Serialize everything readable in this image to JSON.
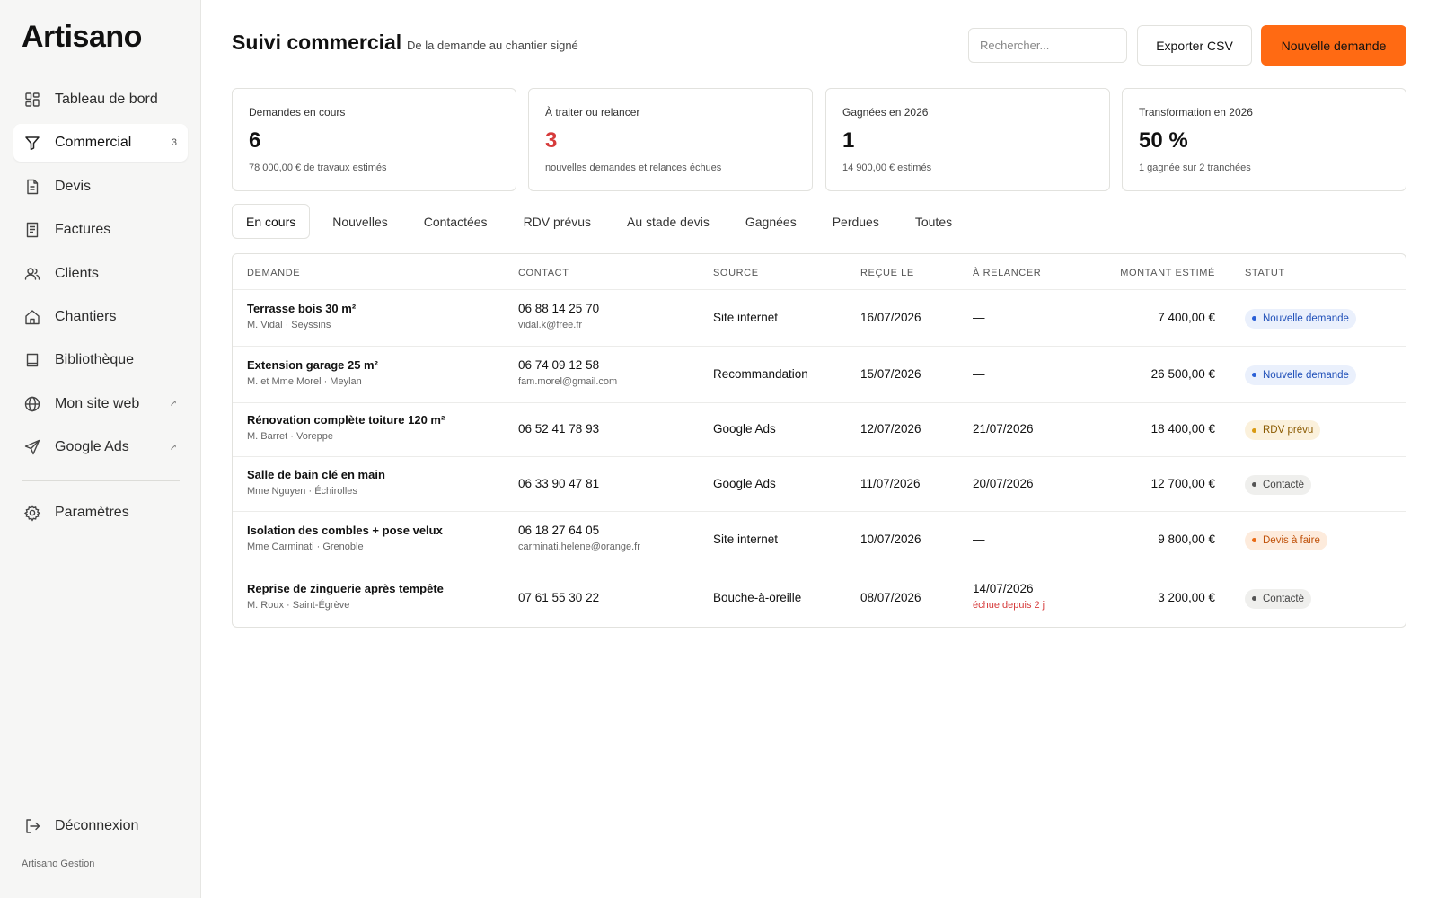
{
  "sidebar": {
    "logo": "Artisano",
    "items": [
      {
        "label": "Tableau de bord",
        "icon": "dashboard-icon"
      },
      {
        "label": "Commercial",
        "icon": "funnel-icon",
        "count": "3"
      },
      {
        "label": "Devis",
        "icon": "document-icon"
      },
      {
        "label": "Factures",
        "icon": "receipt-icon"
      },
      {
        "label": "Clients",
        "icon": "users-icon"
      },
      {
        "label": "Chantiers",
        "icon": "home-icon"
      },
      {
        "label": "Bibliothèque",
        "icon": "book-icon"
      },
      {
        "label": "Mon site web",
        "icon": "globe-icon",
        "ext": "↗"
      },
      {
        "label": "Google Ads",
        "icon": "send-icon",
        "ext": "↗"
      }
    ],
    "settings": "Paramètres",
    "logout": "Déconnexion",
    "footer": "Artisano Gestion"
  },
  "header": {
    "title": "Suivi commercial",
    "subtitle": "De la demande au chantier signé",
    "search_placeholder": "Rechercher...",
    "export_label": "Exporter CSV",
    "new_label": "Nouvelle demande"
  },
  "kpis": [
    {
      "label": "Demandes en cours",
      "value": "6",
      "sub": "78 000,00 € de travaux estimés"
    },
    {
      "label": "À traiter ou relancer",
      "value": "3",
      "sub": "nouvelles demandes et relances échues"
    },
    {
      "label": "Gagnées en 2026",
      "value": "1",
      "sub": "14 900,00 € estimés"
    },
    {
      "label": "Transformation en 2026",
      "value": "50 %",
      "sub": "1 gagnée sur 2 tranchées"
    }
  ],
  "tabs": [
    "En cours",
    "Nouvelles",
    "Contactées",
    "RDV prévus",
    "Au stade devis",
    "Gagnées",
    "Perdues",
    "Toutes"
  ],
  "table": {
    "headers": [
      "Demande",
      "Contact",
      "Source",
      "Reçue le",
      "À relancer",
      "Montant estimé",
      "Statut"
    ],
    "rows": [
      {
        "title": "Terrasse bois 30 m²",
        "client": "M. Vidal · Seyssins",
        "phone": "06 88 14 25 70",
        "email": "vidal.k@free.fr",
        "source": "Site internet",
        "received": "16/07/2026",
        "followup": "—",
        "followup_note": "",
        "amount": "7 400,00 €",
        "status": "Nouvelle demande",
        "status_color": "blue"
      },
      {
        "title": "Extension garage 25 m²",
        "client": "M. et Mme Morel · Meylan",
        "phone": "06 74 09 12 58",
        "email": "fam.morel@gmail.com",
        "source": "Recommandation",
        "received": "15/07/2026",
        "followup": "—",
        "followup_note": "",
        "amount": "26 500,00 €",
        "status": "Nouvelle demande",
        "status_color": "blue"
      },
      {
        "title": "Rénovation complète toiture 120 m²",
        "client": "M. Barret · Voreppe",
        "phone": "06 52 41 78 93",
        "email": "",
        "source": "Google Ads",
        "received": "12/07/2026",
        "followup": "21/07/2026",
        "followup_note": "",
        "amount": "18 400,00 €",
        "status": "RDV prévu",
        "status_color": "amber"
      },
      {
        "title": "Salle de bain clé en main",
        "client": "Mme Nguyen · Échirolles",
        "phone": "06 33 90 47 81",
        "email": "",
        "source": "Google Ads",
        "received": "11/07/2026",
        "followup": "20/07/2026",
        "followup_note": "",
        "amount": "12 700,00 €",
        "status": "Contacté",
        "status_color": "grey"
      },
      {
        "title": "Isolation des combles + pose velux",
        "client": "Mme Carminati · Grenoble",
        "phone": "06 18 27 64 05",
        "email": "carminati.helene@orange.fr",
        "source": "Site internet",
        "received": "10/07/2026",
        "followup": "—",
        "followup_note": "",
        "amount": "9 800,00 €",
        "status": "Devis à faire",
        "status_color": "orange"
      },
      {
        "title": "Reprise de zinguerie après tempête",
        "client": "M. Roux · Saint-Égrève",
        "phone": "07 61 55 30 22",
        "email": "",
        "source": "Bouche-à-oreille",
        "received": "08/07/2026",
        "followup": "14/07/2026",
        "followup_note": "échue depuis 2 j",
        "amount": "3 200,00 €",
        "status": "Contacté",
        "status_color": "grey"
      }
    ]
  },
  "colors": {
    "accent": "#ff6a13",
    "alert": "#d63a3a"
  }
}
